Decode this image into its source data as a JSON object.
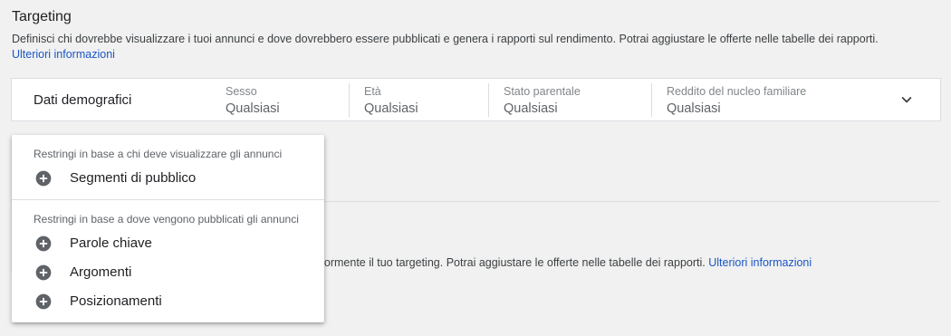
{
  "targeting": {
    "title": "Targeting",
    "description": "Definisci chi dovrebbe visualizzare i tuoi annunci e dove dovrebbero essere pubblicati e genera i rapporti sul rendimento. Potrai aggiustare le offerte nelle tabelle dei rapporti.",
    "learn_more": "Ulteriori informazioni"
  },
  "demographics": {
    "title": "Dati demografici",
    "fields": [
      {
        "label": "Sesso",
        "value": "Qualsiasi"
      },
      {
        "label": "Età",
        "value": "Qualsiasi"
      },
      {
        "label": "Stato parentale",
        "value": "Qualsiasi"
      },
      {
        "label": "Reddito del nucleo familiare",
        "value": "Qualsiasi"
      }
    ],
    "expand_icon": "chevron-down-icon"
  },
  "background": {
    "partial_text": "eriormente il tuo targeting. Potrai aggiustare le offerte nelle tabelle dei rapporti.",
    "learn_more": "Ulteriori informazioni"
  },
  "menu": {
    "group1_label": "Restringi in base a chi deve visualizzare gli annunci",
    "group2_label": "Restringi in base a dove vengono pubblicati gli annunci",
    "items": [
      {
        "label": "Segmenti di pubblico",
        "icon": "add-circle-icon"
      },
      {
        "label": "Parole chiave",
        "icon": "add-circle-icon"
      },
      {
        "label": "Argomenti",
        "icon": "add-circle-icon"
      },
      {
        "label": "Posizionamenti",
        "icon": "add-circle-icon"
      }
    ]
  },
  "colors": {
    "link": "#1a56c4",
    "background": "#f1f1f1",
    "icon": "#5f6368"
  }
}
